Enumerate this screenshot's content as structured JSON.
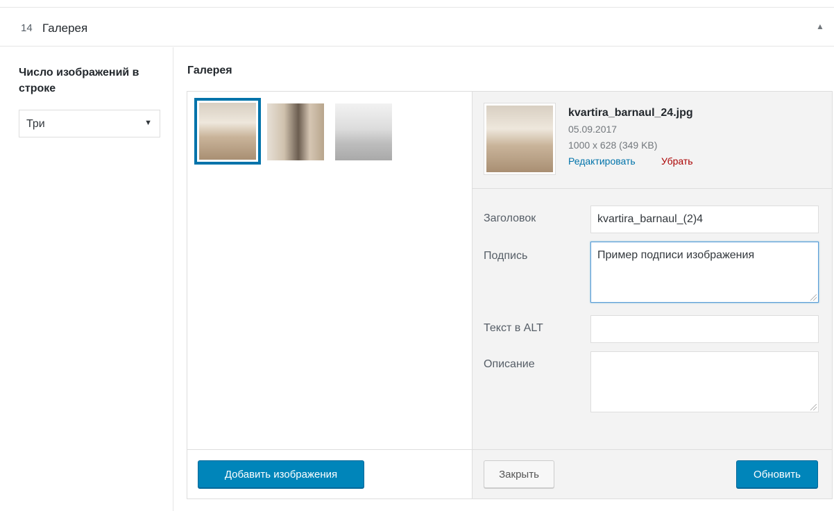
{
  "header": {
    "count": "14",
    "title": "Галерея",
    "toggle_icon": "triangle-up-icon"
  },
  "sidebar": {
    "label": "Число изображений в строке",
    "select_value": "Три"
  },
  "gallery": {
    "label": "Галерея",
    "thumbnails": [
      {
        "selected": true
      },
      {
        "selected": false
      },
      {
        "selected": false
      }
    ],
    "add_button": "Добавить изображения"
  },
  "attachment": {
    "filename": "kvartira_barnaul_24.jpg",
    "date": "05.09.2017",
    "dimensions": "1000 x 628 (349 KB)",
    "edit_link": "Редактировать",
    "remove_link": "Убрать",
    "fields": {
      "title_label": "Заголовок",
      "title_value": "kvartira_barnaul_(2)4",
      "caption_label": "Подпись",
      "caption_value": "Пример подписи изображения",
      "alt_label": "Текст в ALT",
      "alt_value": "",
      "description_label": "Описание",
      "description_value": ""
    },
    "close_button": "Закрыть",
    "update_button": "Обновить"
  },
  "colors": {
    "accent": "#0085ba",
    "link": "#0073aa",
    "danger": "#aa0000"
  }
}
